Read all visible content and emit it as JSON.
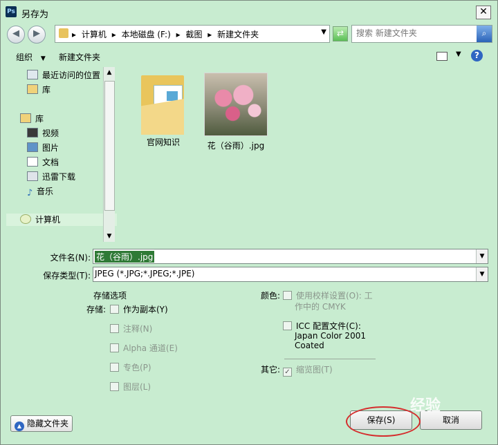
{
  "window": {
    "title": "另存为",
    "app_icon": "Ps"
  },
  "address": {
    "crumbs": [
      "计算机",
      "本地磁盘 (F:)",
      "截图",
      "新建文件夹"
    ],
    "search_placeholder": "搜索 新建文件夹"
  },
  "toolbar": {
    "organize": "组织",
    "new_folder": "新建文件夹"
  },
  "sidebar": {
    "items": [
      {
        "label": "最近访问的位置",
        "icon": "recent-icon"
      },
      {
        "label": "库",
        "icon": "library-icon"
      },
      {
        "label": "库",
        "icon": "library-icon"
      },
      {
        "label": "视频",
        "icon": "video-icon"
      },
      {
        "label": "图片",
        "icon": "pictures-icon"
      },
      {
        "label": "文档",
        "icon": "documents-icon"
      },
      {
        "label": "迅雷下载",
        "icon": "download-icon"
      },
      {
        "label": "音乐",
        "icon": "music-icon"
      },
      {
        "label": "计算机",
        "icon": "computer-icon"
      }
    ]
  },
  "files": [
    {
      "name": "官网知识",
      "type": "folder"
    },
    {
      "name": "花（谷雨）.jpg",
      "type": "image"
    }
  ],
  "form": {
    "filename_label": "文件名(N):",
    "filename_value": "花（谷雨）.jpg",
    "filetype_label": "保存类型(T):",
    "filetype_value": "JPEG (*.JPG;*.JPEG;*.JPE)"
  },
  "options": {
    "section_title": "存储选项",
    "save_label": "存储:",
    "as_copy": "作为副本(Y)",
    "annotations": "注释(N)",
    "alpha": "Alpha 通道(E)",
    "spot": "专色(P)",
    "layers": "图层(L)",
    "color_label": "颜色:",
    "proof_line1": "使用校样设置(O): 工",
    "proof_line2": "作中的 CMYK",
    "icc_label": "ICC 配置文件(C):",
    "icc_line2": "Japan Color 2001",
    "icc_line3": "Coated",
    "other_label": "其它:",
    "thumbnail": "缩览图(T)"
  },
  "buttons": {
    "hide_folders": "隐藏文件夹",
    "save": "保存(S)",
    "cancel": "取消"
  },
  "watermark": "经验"
}
